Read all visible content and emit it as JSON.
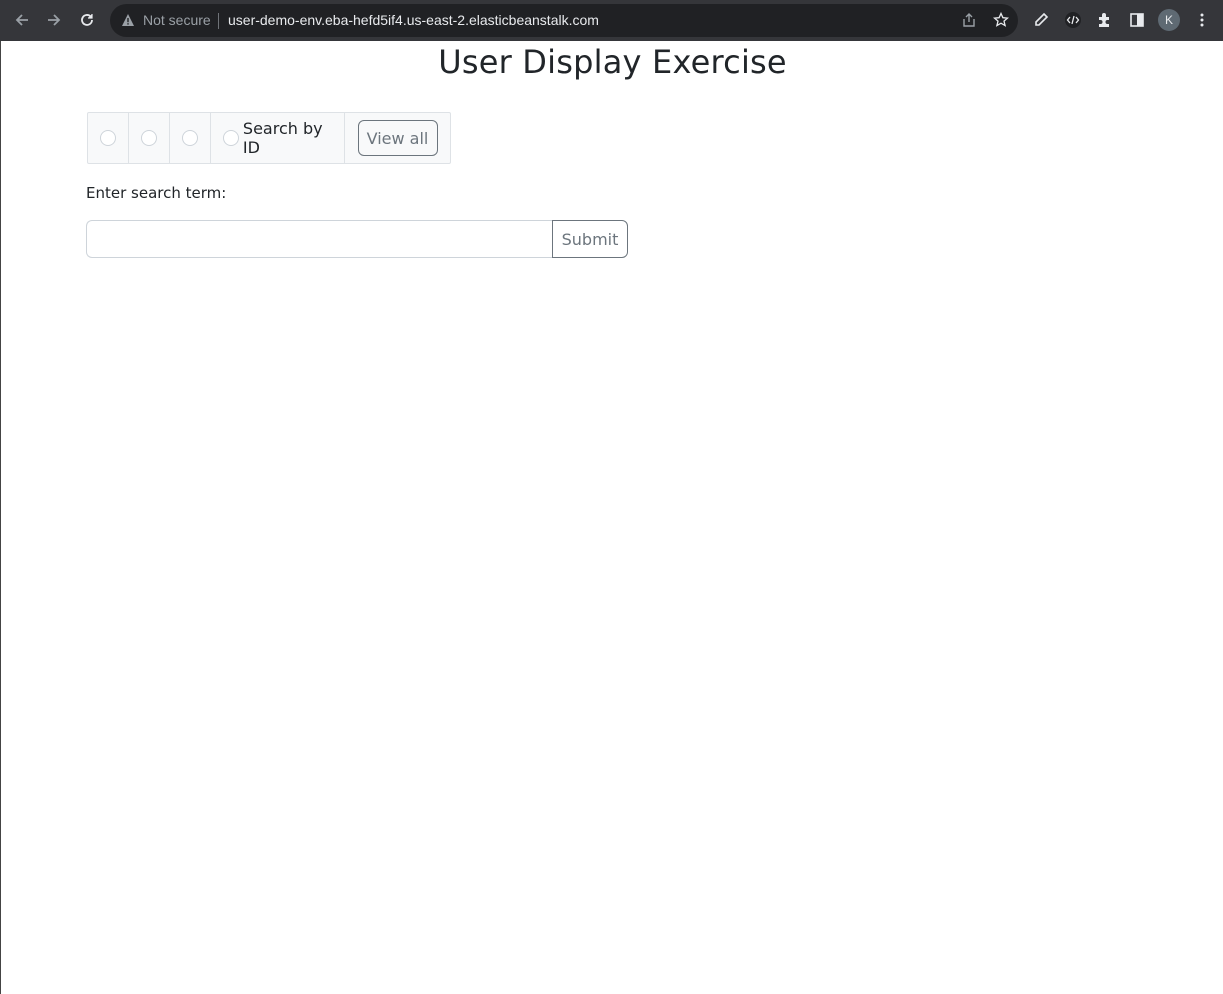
{
  "browser": {
    "security_label": "Not secure",
    "url": "user-demo-env.eba-hefd5if4.us-east-2.elasticbeanstalk.com",
    "profile_initial": "K",
    "icons": [
      "back-icon",
      "forward-icon",
      "reload-icon",
      "warning-icon",
      "share-icon",
      "star-icon",
      "eyedropper-icon",
      "extension-code-icon",
      "puzzle-icon",
      "side-panel-icon",
      "menu-icon"
    ]
  },
  "page": {
    "title": "User Display Exercise",
    "options": {
      "search_by_id_label": "Search by ID",
      "view_all_label": "View all"
    },
    "search": {
      "label": "Enter search term:",
      "value": "",
      "placeholder": "",
      "submit_label": "Submit"
    }
  },
  "colors": {
    "chrome_bg": "#35363a",
    "omnibox_bg": "#202124",
    "text_dark": "#212529",
    "secondary": "#6c757d",
    "group_bg": "#f8f9fa"
  }
}
